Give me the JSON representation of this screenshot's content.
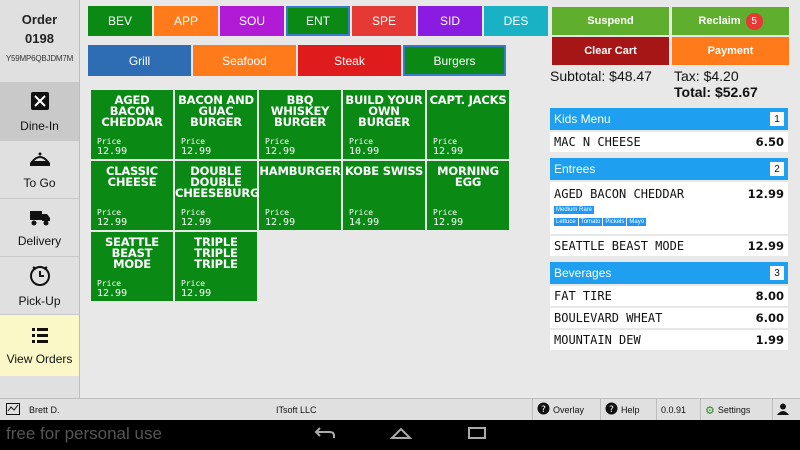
{
  "order": {
    "label": "Order",
    "number": "0198",
    "code": "Y59MP6QBJDM7M"
  },
  "sidebar": [
    {
      "icon": "dine-in-icon",
      "label": "Dine-In"
    },
    {
      "icon": "to-go-icon",
      "label": "To Go"
    },
    {
      "icon": "delivery-icon",
      "label": "Delivery"
    },
    {
      "icon": "pick-up-icon",
      "label": "Pick-Up"
    },
    {
      "icon": "view-orders-icon",
      "label": "View Orders"
    }
  ],
  "categories": [
    {
      "label": "BEV",
      "color": "#0a8a14"
    },
    {
      "label": "APP",
      "color": "#ff7a1a"
    },
    {
      "label": "SOU",
      "color": "#b21bd6"
    },
    {
      "label": "ENT",
      "color": "#0a8a14",
      "selected": true
    },
    {
      "label": "SPE",
      "color": "#e53935"
    },
    {
      "label": "SID",
      "color": "#8a1be0"
    },
    {
      "label": "DES",
      "color": "#19b2c4"
    }
  ],
  "subcategories": [
    {
      "label": "Grill",
      "color": "#2e6cb4"
    },
    {
      "label": "Seafood",
      "color": "#ff7a1a"
    },
    {
      "label": "Steak",
      "color": "#e01b1b"
    },
    {
      "label": "Burgers",
      "color": "#0a8a14",
      "selected": true
    }
  ],
  "items": [
    {
      "name": "AGED BACON CHEDDAR",
      "price_label": "Price",
      "price": "12.99"
    },
    {
      "name": "BACON AND GUAC BURGER",
      "price_label": "Price",
      "price": "12.99"
    },
    {
      "name": "BBQ WHISKEY BURGER",
      "price_label": "Price",
      "price": "12.99"
    },
    {
      "name": "BUILD YOUR OWN BURGER",
      "price_label": "Price",
      "price": "10.99"
    },
    {
      "name": "CAPT. JACKS",
      "price_label": "Price",
      "price": "12.99"
    },
    {
      "name": "CLASSIC CHEESE",
      "price_label": "Price",
      "price": "12.99"
    },
    {
      "name": "DOUBLE DOUBLE CHEESEBURGE",
      "price_label": "Price",
      "price": "12.99"
    },
    {
      "name": "HAMBURGER",
      "price_label": "Price",
      "price": "12.99"
    },
    {
      "name": "KOBE SWISS",
      "price_label": "Price",
      "price": "14.99"
    },
    {
      "name": "MORNING EGG",
      "price_label": "Price",
      "price": "12.99"
    },
    {
      "name": "SEATTLE BEAST MODE",
      "price_label": "Price",
      "price": "12.99"
    },
    {
      "name": "TRIPLE TRIPLE TRIPLE",
      "price_label": "Price",
      "price": "12.99"
    }
  ],
  "actions": {
    "suspend": "Suspend",
    "reclaim": "Reclaim",
    "reclaim_count": "5",
    "clear_cart": "Clear Cart",
    "payment": "Payment"
  },
  "totals": {
    "subtotal": "Subtotal: $48.47",
    "tax": "Tax: $4.20",
    "total": "Total: $52.67"
  },
  "cart": {
    "kids": {
      "title": "Kids Menu",
      "count": "1",
      "items": [
        {
          "name": "MAC N CHEESE",
          "price": "6.50"
        }
      ]
    },
    "entrees": {
      "title": "Entrees",
      "count": "2",
      "aged": {
        "name": "AGED BACON CHEDDAR",
        "price": "12.99",
        "cook": "Medium Rare",
        "mods": [
          "Lettuce",
          "Tomato",
          "Pickels",
          "Mayo"
        ]
      },
      "seattle": {
        "name": "SEATTLE BEAST MODE",
        "price": "12.99"
      }
    },
    "beverages": {
      "title": "Beverages",
      "count": "3",
      "items": [
        {
          "name": "FAT TIRE",
          "price": "8.00"
        },
        {
          "name": "BOULEVARD WHEAT",
          "price": "6.00"
        },
        {
          "name": "MOUNTAIN DEW",
          "price": "1.99"
        }
      ]
    }
  },
  "status": {
    "user": "Brett D.",
    "company": "ITsoft LLC",
    "overlay": "Overlay",
    "help": "Help",
    "version": "0.0.91",
    "settings": "Settings"
  },
  "watermark": "free for personal use"
}
